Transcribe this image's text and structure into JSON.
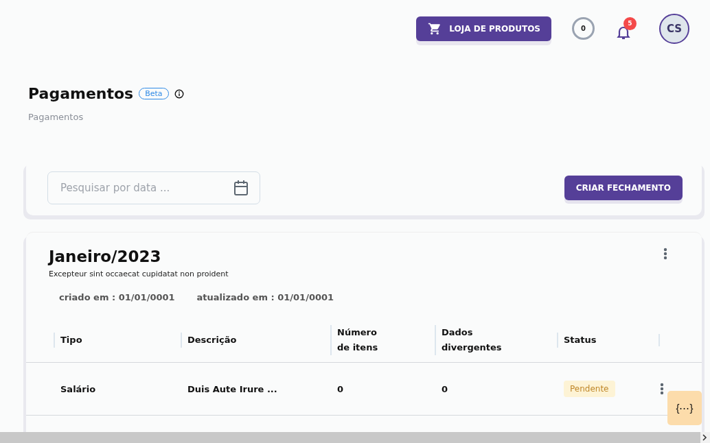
{
  "header": {
    "store_button": "LOJA DE PRODUTOS",
    "counter": "0",
    "notifications": "5",
    "avatar": "CS"
  },
  "page": {
    "title": "Pagamentos",
    "badge": "Beta",
    "breadcrumb": "Pagamentos"
  },
  "filter": {
    "placeholder": "Pesquisar por data ...",
    "button": "CRIAR FECHAMENTO"
  },
  "closing": {
    "title": "Janeiro/2023",
    "description": "Excepteur sint occaecat cupidatat non proident",
    "created": "criado em : 01/01/0001",
    "updated": "atualizado em : 01/01/0001"
  },
  "table": {
    "columns": [
      "Tipo",
      "Descrição",
      "Número de itens",
      "Dados divergentes",
      "Status"
    ],
    "rows": [
      {
        "cells": [
          "Salário",
          "Duis Aute Irure ...",
          "0",
          "0"
        ],
        "status": "Pendente"
      }
    ]
  },
  "floating_button": "{⋯}"
}
